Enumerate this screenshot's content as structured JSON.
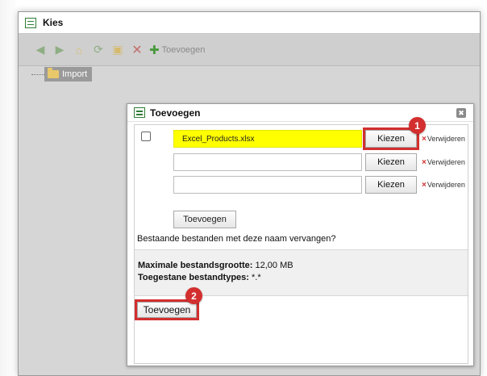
{
  "window": {
    "title": "Kies"
  },
  "toolbar": {
    "add_label": "Toevoegen",
    "icons": [
      "arrow-left-icon",
      "arrow-right-icon",
      "home-folder-icon",
      "refresh-icon",
      "new-folder-icon",
      "delete-icon",
      "plus-icon"
    ]
  },
  "tree": {
    "node_label": "Import"
  },
  "dialog": {
    "title": "Toevoegen",
    "files": [
      {
        "value": "Excel_Products.xlsx",
        "choose_label": "Kiezen",
        "remove_label": "Verwijderen"
      },
      {
        "value": "",
        "choose_label": "Kiezen",
        "remove_label": "Verwijderen"
      },
      {
        "value": "",
        "choose_label": "Kiezen",
        "remove_label": "Verwijderen"
      }
    ],
    "add_more_label": "Toevoegen",
    "replace_question": "Bestaande bestanden met deze naam vervangen?",
    "max_size_label": "Maximale bestandsgrootte:",
    "max_size_value": "12,00 MB",
    "allowed_types_label": "Toegestane bestandtypes:",
    "allowed_types_value": "*.*",
    "submit_label": "Toevoegen"
  },
  "annotations": {
    "marker_1": "1",
    "marker_2": "2",
    "highlight_color": "#ffff00",
    "marker_color": "#d32f2f"
  }
}
